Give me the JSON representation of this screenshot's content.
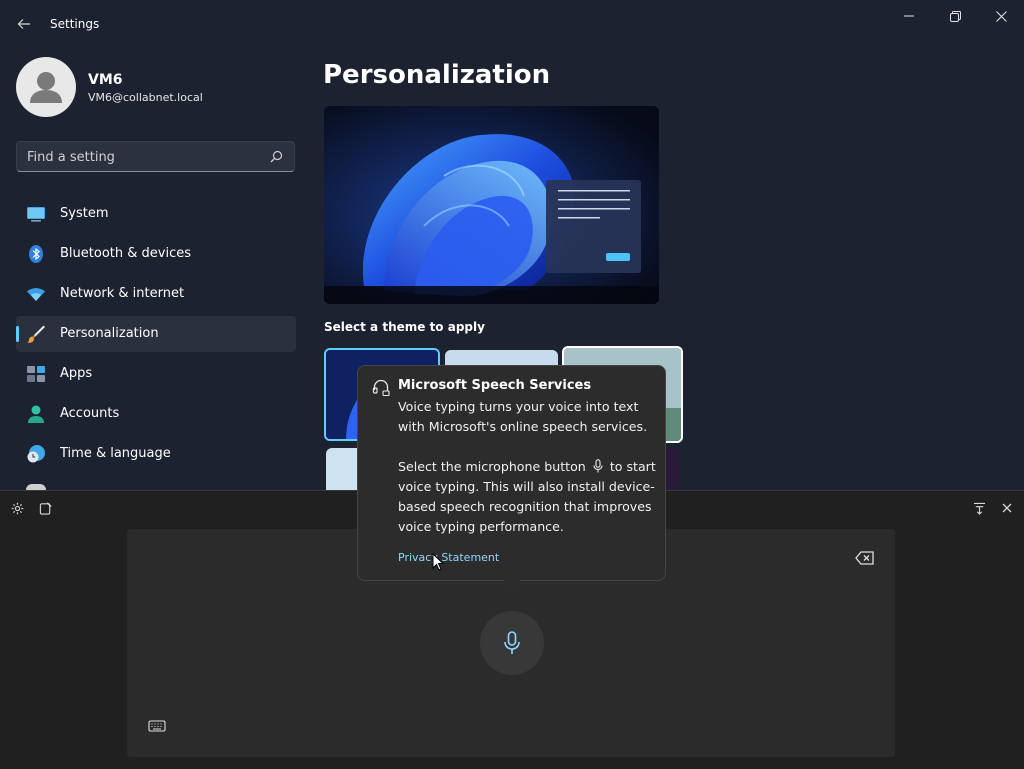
{
  "window": {
    "title": "Settings",
    "back_icon": "arrow-left-icon",
    "minimize_icon": "minimize-icon",
    "restore_icon": "restore-icon",
    "close_icon": "close-icon"
  },
  "user": {
    "name": "VM6",
    "email": "VM6@collabnet.local"
  },
  "search": {
    "placeholder": "Find a setting",
    "icon": "search-icon"
  },
  "nav": {
    "items": [
      {
        "label": "System",
        "icon": "system-icon",
        "selected": false
      },
      {
        "label": "Bluetooth & devices",
        "icon": "bluetooth-icon",
        "selected": false
      },
      {
        "label": "Network & internet",
        "icon": "wifi-icon",
        "selected": false
      },
      {
        "label": "Personalization",
        "icon": "brush-icon",
        "selected": true
      },
      {
        "label": "Apps",
        "icon": "apps-icon",
        "selected": false
      },
      {
        "label": "Accounts",
        "icon": "accounts-icon",
        "selected": false
      },
      {
        "label": "Time & language",
        "icon": "clock-globe-icon",
        "selected": false
      }
    ]
  },
  "main": {
    "title": "Personalization",
    "theme_section_label": "Select a theme to apply"
  },
  "voice_panel": {
    "settings_icon": "gear-icon",
    "pin_icon": "clipboard-icon",
    "dock_icon": "dock-icon",
    "close_icon": "close-icon",
    "backspace_icon": "backspace-icon",
    "mic_icon": "microphone-icon",
    "keyboard_icon": "keyboard-icon"
  },
  "tooltip": {
    "title": "Microsoft Speech Services",
    "para1_line1": "Voice typing turns your voice into text",
    "para1_line2": "with Microsoft's online speech services.",
    "para2_line1_start": "Select the microphone button",
    "para2_line1_end": "to start",
    "para2_line2": "voice typing. This will also install device-",
    "para2_line3": "based speech recognition that improves",
    "para2_line4": "voice typing performance.",
    "link": "Privacy Statement"
  },
  "colors": {
    "accent": "#60cdff",
    "background": "#1c2230",
    "panel": "#202020",
    "tooltip": "#2c2c2c"
  }
}
